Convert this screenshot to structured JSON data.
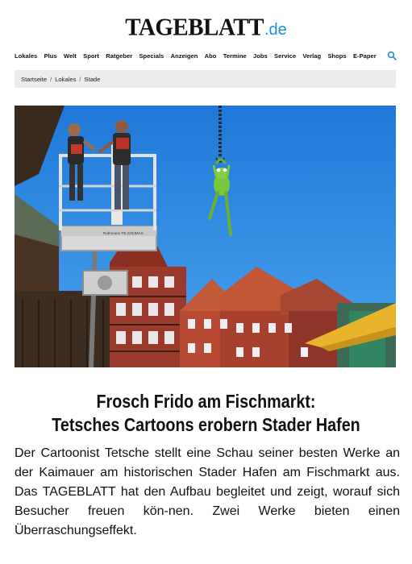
{
  "header": {
    "logo_main": "TAGEBLATT",
    "logo_tld": ".de"
  },
  "nav": {
    "items": [
      "Lokales",
      "Plus",
      "Welt",
      "Sport",
      "Ratgeber",
      "Specials",
      "Anzeigen",
      "Abo",
      "Termine",
      "Jobs",
      "Service",
      "Verlag",
      "Shops",
      "E-Paper"
    ],
    "search_icon": "search-icon"
  },
  "breadcrumb": {
    "items": [
      "Startseite",
      "Lokales",
      "Stade"
    ],
    "separator": "/"
  },
  "article": {
    "headline_line1": "Frosch Frido am Fischmarkt:",
    "headline_line2": "Tetsches Cartoons erobern Stader Hafen",
    "teaser": "Der Cartoonist Tetsche stellt eine Schau seiner besten Werke an der Kaimauer am historischen Stader Hafen am Fischmarkt aus. Das TAGEBLATT hat den Aufbau begleitet und zeigt, worauf sich Besucher freuen kön-nen. Zwei Werke bieten einen Überraschungseffekt.",
    "lift_label": "Ruthmann TB 220/IMAS"
  },
  "colors": {
    "accent": "#1f8fd6",
    "sky": "#2f8ae0",
    "breadcrumb_bg": "#ebecee",
    "frog": "#7cc63a"
  }
}
